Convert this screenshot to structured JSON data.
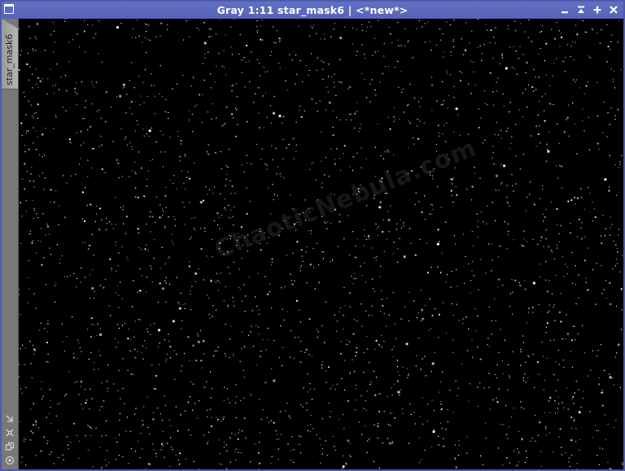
{
  "window": {
    "title": "Gray 1:11 star_mask6 | <*new*>",
    "accent_color": "#5a66b5"
  },
  "controls": {
    "minimize_icon": "minimize-icon",
    "shade_icon": "shade-icon",
    "maximize_icon": "maximize-icon",
    "close_icon": "close-icon"
  },
  "sidebar": {
    "view_tab_label": "star_mask6",
    "tools": [
      "pin-icon",
      "fit-view-icon",
      "clone-view-icon",
      "target-icon"
    ]
  },
  "canvas": {
    "background_color": "#000000",
    "watermark": "ChaoticNebula.com"
  }
}
